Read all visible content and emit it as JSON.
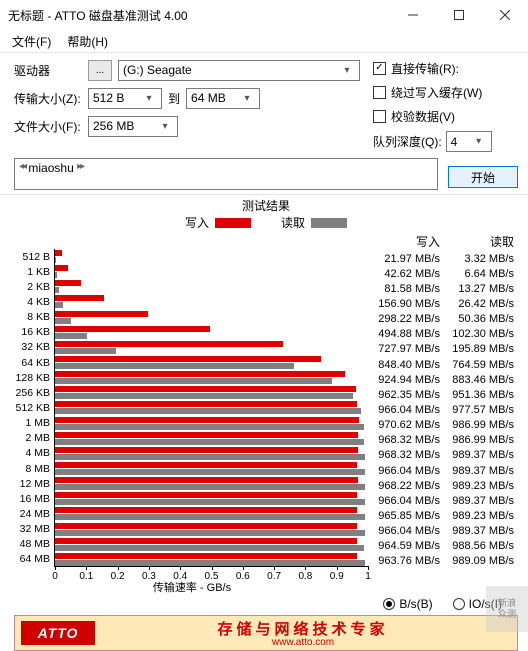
{
  "window": {
    "title": "无标题 - ATTO 磁盘基准测试 4.00"
  },
  "menu": {
    "file": "文件(F)",
    "help": "帮助(H)"
  },
  "labels": {
    "drive": "驱动器",
    "browse": "...",
    "transfer_size": "传输大小(Z):",
    "to": "到",
    "file_size": "文件大小(F):",
    "direct_io": "直接传输(R):",
    "bypass_cache": "绕过写入缓存(W)",
    "verify": "校验数据(V)",
    "queue_depth": "队列深度(Q):",
    "start": "开始",
    "results_title": "测试结果",
    "legend_write": "写入",
    "legend_read": "读取",
    "xlabel": "传输速率 - GB/s",
    "unit_bytes": "B/s(B)",
    "unit_io": "IO/s(I)",
    "col_write": "写入",
    "col_read": "读取"
  },
  "values": {
    "drive": "(G:) Seagate",
    "size_min": "512 B",
    "size_max": "64 MB",
    "file_size": "256 MB",
    "queue_depth": "4",
    "description": "miaoshu",
    "direct_io_checked": true,
    "bypass_cache_checked": false,
    "verify_checked": false,
    "unit_bytes_selected": true
  },
  "banner": {
    "logo": "ATTO",
    "text": "存储与网络技术专家",
    "url": "www.atto.com"
  },
  "watermark": {
    "l1": "新浪",
    "l2": "众测"
  },
  "chart_data": {
    "type": "bar",
    "title": "测试结果",
    "xlabel": "传输速率 - GB/s",
    "ylabel": "",
    "xlim_gb": [
      0,
      1
    ],
    "xticks": [
      0,
      0.1,
      0.2,
      0.3,
      0.4,
      0.5,
      0.6,
      0.7,
      0.8,
      0.9,
      1
    ],
    "unit": "MB/s",
    "series_names": [
      "写入",
      "读取"
    ],
    "rows": [
      {
        "label": "512 B",
        "write": 21.97,
        "read": 3.32
      },
      {
        "label": "1 KB",
        "write": 42.62,
        "read": 6.64
      },
      {
        "label": "2 KB",
        "write": 81.58,
        "read": 13.27
      },
      {
        "label": "4 KB",
        "write": 156.9,
        "read": 26.42
      },
      {
        "label": "8 KB",
        "write": 298.22,
        "read": 50.36
      },
      {
        "label": "16 KB",
        "write": 494.88,
        "read": 102.3
      },
      {
        "label": "32 KB",
        "write": 727.97,
        "read": 195.89
      },
      {
        "label": "64 KB",
        "write": 848.4,
        "read": 764.59
      },
      {
        "label": "128 KB",
        "write": 924.94,
        "read": 883.46
      },
      {
        "label": "256 KB",
        "write": 962.35,
        "read": 951.36
      },
      {
        "label": "512 KB",
        "write": 966.04,
        "read": 977.57
      },
      {
        "label": "1 MB",
        "write": 970.62,
        "read": 986.99
      },
      {
        "label": "2 MB",
        "write": 968.32,
        "read": 986.99
      },
      {
        "label": "4 MB",
        "write": 968.32,
        "read": 989.37
      },
      {
        "label": "8 MB",
        "write": 966.04,
        "read": 989.37
      },
      {
        "label": "12 MB",
        "write": 968.22,
        "read": 989.23
      },
      {
        "label": "16 MB",
        "write": 966.04,
        "read": 989.37
      },
      {
        "label": "24 MB",
        "write": 965.85,
        "read": 989.23
      },
      {
        "label": "32 MB",
        "write": 966.04,
        "read": 989.37
      },
      {
        "label": "48 MB",
        "write": 964.59,
        "read": 988.56
      },
      {
        "label": "64 MB",
        "write": 963.76,
        "read": 989.09
      }
    ]
  }
}
